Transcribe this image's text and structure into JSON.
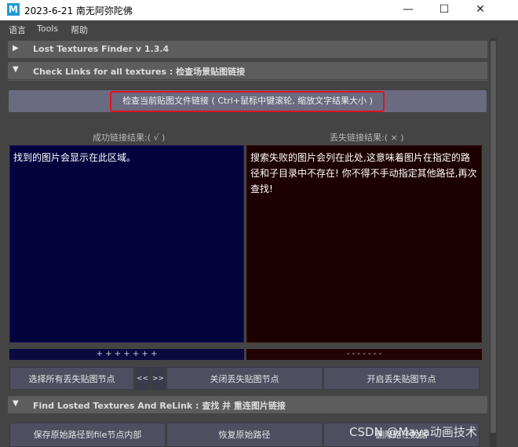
{
  "window": {
    "title": "2023-6-21 南无阿弥陀佛",
    "icon_letter": "M",
    "minimize_symbol": "—",
    "maximize_symbol": "☐",
    "close_symbol": "✕"
  },
  "menu": {
    "items": [
      "语言",
      "Tools",
      "帮助"
    ]
  },
  "sections": {
    "lost_textures": {
      "label": "Lost Textures Finder  v 1.3.4",
      "arrow": "▶",
      "expanded": false
    },
    "check_links": {
      "label": "Check Links for all textures : 检查场景贴图链接",
      "arrow": "▼",
      "expanded": true
    },
    "find_relink": {
      "label": "Find Losted Textures  And  ReLink : 查找 并 重连图片链接",
      "arrow": "▼",
      "expanded": true
    }
  },
  "check_button": {
    "label": "检查当前贴图文件链接  ( Ctrl+鼠标中键滚轮, 缩放文字结果大小 )"
  },
  "results": {
    "success_title": "成功链接结果:( √ )",
    "fail_title": "丢失链接结果:( × )",
    "success_text": "找到的图片会显示在此区域。",
    "fail_text": "搜索失败的图片会列在此处,这意味着图片在指定的路径和子目录中不存在! 你不得不手动指定其他路径,再次查找!",
    "success_bar": "+ + + + + + +",
    "fail_bar": "- - - - - - -"
  },
  "buttons": {
    "select_all_lost": "选择所有丢失贴图节点",
    "prev": "<<",
    "next": ">>",
    "close_lost": "关闭丢失贴图节点",
    "open_lost": "开启丢失贴图节点",
    "save_path": "保存原始路径到file节点内部",
    "restore_path": "恢复原始路径",
    "delete_path_data": "删除路径数据"
  },
  "watermark": "CSDN @Maya动画技术",
  "colors": {
    "success_panel_bg": "#03033e",
    "fail_panel_bg": "#1d0000",
    "highlight_border": "#e0141e",
    "main_bg": "#444444"
  }
}
